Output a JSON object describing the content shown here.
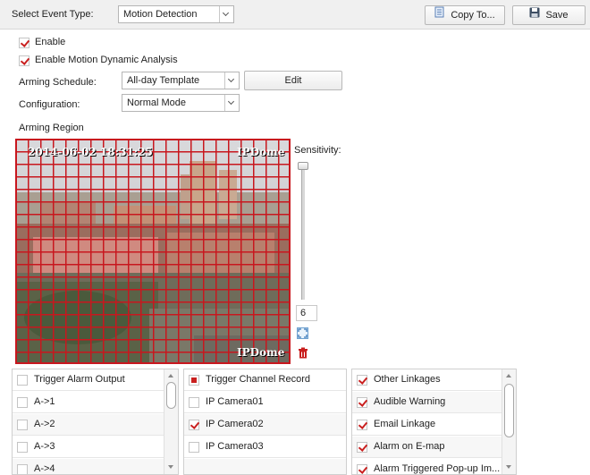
{
  "header": {
    "event_type_label": "Select Event Type:",
    "event_type_value": "Motion Detection",
    "copy_label": "Copy To...",
    "save_label": "Save"
  },
  "options": {
    "enable_label": "Enable",
    "enable_checked": true,
    "dynamic_label": "Enable Motion Dynamic Analysis",
    "dynamic_checked": true
  },
  "schedule": {
    "label": "Arming Schedule:",
    "value": "All-day Template",
    "edit_label": "Edit"
  },
  "configuration": {
    "label": "Configuration:",
    "value": "Normal Mode"
  },
  "region": {
    "title": "Arming Region",
    "osd_time": "2014-06-02 18:31:25",
    "osd_camera": "IPDome",
    "osd_corner": "IPDome"
  },
  "sensitivity": {
    "label": "Sensitivity:",
    "value": "6"
  },
  "icons": {
    "fullscreen": "expand-icon",
    "delete": "trash-icon",
    "copy": "document-icon",
    "save": "floppy-disk-icon"
  },
  "colors": {
    "accent": "#c9201f",
    "grid": "#c8171e"
  },
  "panels": {
    "alarm_output": {
      "header": "Trigger Alarm Output",
      "items": [
        "A->1",
        "A->2",
        "A->3",
        "A->4"
      ]
    },
    "channel_record": {
      "header": "Trigger Channel Record",
      "items": [
        {
          "label": "IP Camera01",
          "checked": false
        },
        {
          "label": "IP Camera02",
          "checked": true
        },
        {
          "label": "IP Camera03",
          "checked": false
        }
      ]
    },
    "other_linkages": {
      "header": "Other Linkages",
      "items": [
        {
          "label": "Audible Warning",
          "checked": true
        },
        {
          "label": "Email Linkage",
          "checked": true
        },
        {
          "label": "Alarm on E-map",
          "checked": true
        },
        {
          "label": "Alarm Triggered Pop-up Im...",
          "checked": true
        }
      ]
    }
  }
}
